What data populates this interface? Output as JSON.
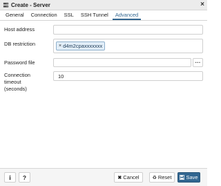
{
  "window": {
    "title": "Create - Server",
    "close_glyph": "×"
  },
  "tabs": [
    {
      "label": "General",
      "active": false
    },
    {
      "label": "Connection",
      "active": false
    },
    {
      "label": "SSL",
      "active": false
    },
    {
      "label": "SSH Tunnel",
      "active": false
    },
    {
      "label": "Advanced",
      "active": true
    }
  ],
  "form": {
    "host_address": {
      "label": "Host address",
      "value": ""
    },
    "db_restriction": {
      "label": "DB restriction",
      "tags": [
        "d4m2cpaxxxxxxx"
      ],
      "remove_glyph": "×"
    },
    "password_file": {
      "label": "Password file",
      "value": "",
      "browse_label": "···"
    },
    "connection_timeout": {
      "label": "Connection timeout (seconds)",
      "label_lines": [
        "Connection",
        "timeout",
        "(seconds)"
      ],
      "value": "10"
    }
  },
  "footer": {
    "info_label": "i",
    "help_label": "?",
    "cancel_label": "Cancel",
    "reset_label": "Reset",
    "save_label": "Save"
  },
  "colors": {
    "accent": "#326690",
    "chip_bg": "#e2eef8"
  },
  "icons": {
    "title": "server-icon",
    "cancel": "close-icon",
    "reset": "reset-icon",
    "save": "save-icon"
  }
}
